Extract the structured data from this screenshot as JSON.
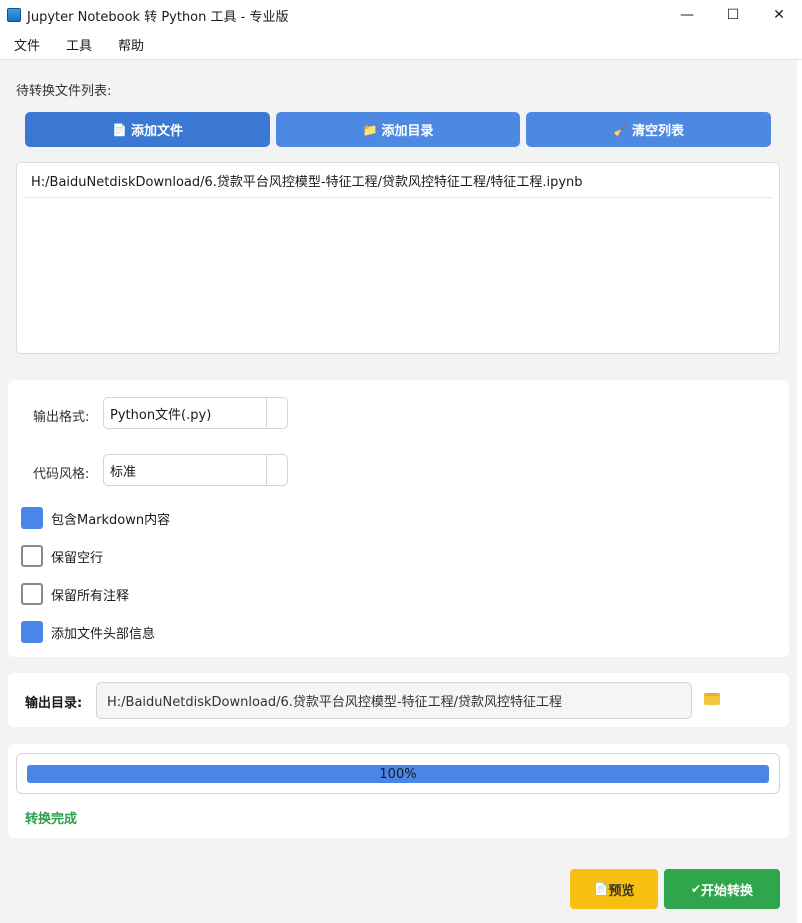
{
  "window": {
    "title": "Jupyter Notebook 转 Python 工具 - 专业版",
    "minimize": "—",
    "maximize": "☐",
    "close": "✕"
  },
  "menu": [
    "文件",
    "工具",
    "帮助"
  ],
  "files_section": {
    "label": "待转换文件列表:",
    "add_file": "添加文件",
    "add_dir": "添加目录",
    "clear": "清空列表",
    "files": [
      "H:/BaiduNetdiskDownload/6.贷款平台风控模型-特征工程/贷款风控特征工程/特征工程.ipynb"
    ]
  },
  "options": {
    "format_label": "输出格式:",
    "format_value": "Python文件(.py)",
    "style_label": "代码风格:",
    "style_value": "标准",
    "checks": [
      {
        "label": "包含Markdown内容",
        "checked": true
      },
      {
        "label": "保留空行",
        "checked": false
      },
      {
        "label": "保留所有注释",
        "checked": false
      },
      {
        "label": "添加文件头部信息",
        "checked": true
      }
    ]
  },
  "output": {
    "label": "输出目录:",
    "path": "H:/BaiduNetdiskDownload/6.贷款平台风控模型-特征工程/贷款风控特征工程"
  },
  "progress": {
    "percent_text": "100%",
    "value": 1.0,
    "status": "转换完成"
  },
  "actions": {
    "preview": "预览",
    "start": "开始转换"
  },
  "colors": {
    "accent": "#4a86e8",
    "success": "#2e9e4a",
    "warning": "#f7bf0f"
  }
}
